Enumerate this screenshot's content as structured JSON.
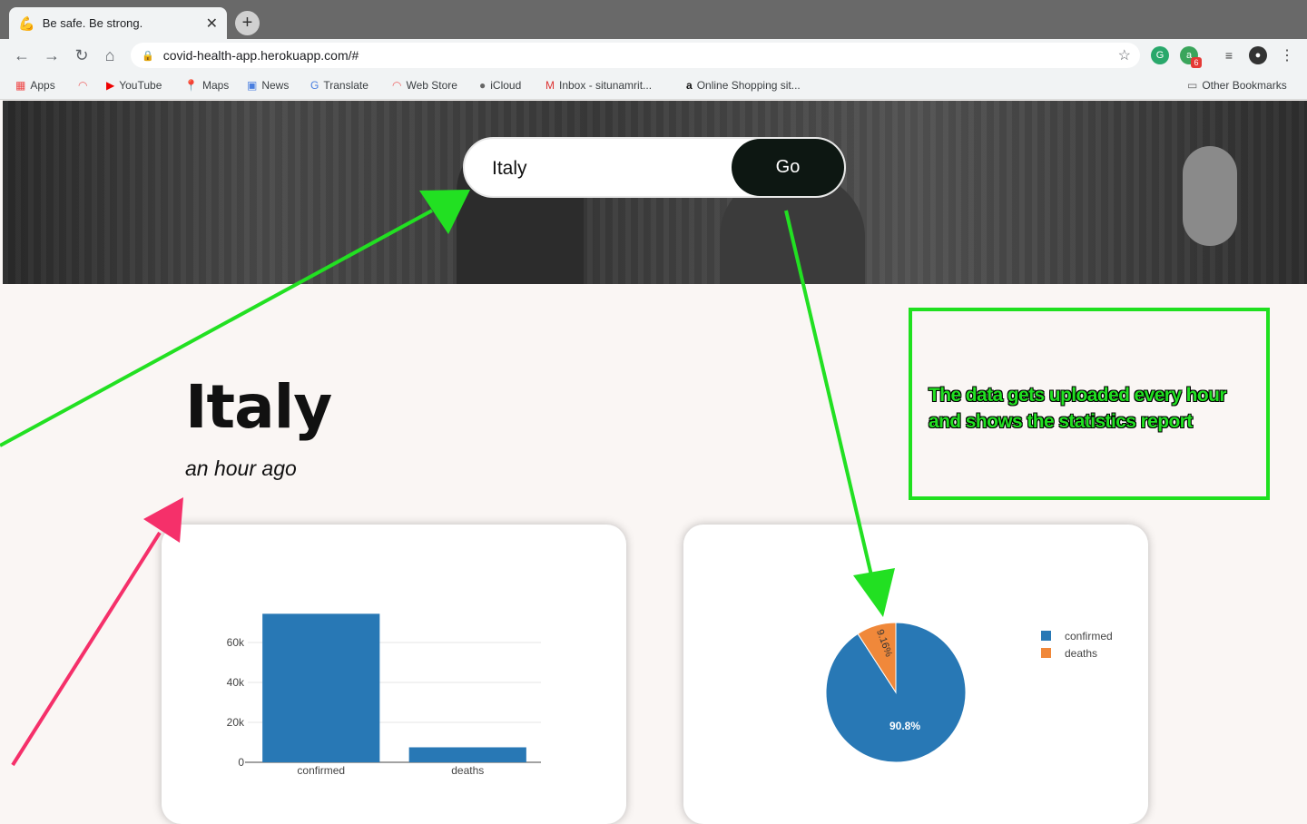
{
  "browser": {
    "tab_title": "Be safe. Be strong.",
    "url": "covid-health-app.herokuapp.com/#",
    "ext_badge": "6",
    "bookmarks": [
      {
        "label": "Apps",
        "icon": "apps-grid-icon"
      },
      {
        "label": "",
        "icon": "rainbow-icon"
      },
      {
        "label": "YouTube",
        "icon": "youtube-icon"
      },
      {
        "label": "Maps",
        "icon": "maps-icon"
      },
      {
        "label": "News",
        "icon": "news-icon"
      },
      {
        "label": "Translate",
        "icon": "translate-icon"
      },
      {
        "label": "Web Store",
        "icon": "webstore-icon"
      },
      {
        "label": "iCloud",
        "icon": "apple-icon"
      },
      {
        "label": "Inbox - situnamrit...",
        "icon": "gmail-icon"
      },
      {
        "label": "Online Shopping sit...",
        "icon": "amazon-icon"
      }
    ],
    "other_bookmarks": "Other Bookmarks"
  },
  "search": {
    "value": "Italy",
    "go_label": "Go"
  },
  "country": {
    "name": "Italy",
    "updated": "an hour ago"
  },
  "annotation": {
    "note": "The data gets uploaded every hour and shows the statistics report",
    "arrow_color": "#22e022",
    "pink_arrow_color": "#f5306a"
  },
  "chart_data": [
    {
      "type": "bar",
      "categories": [
        "confirmed",
        "deaths"
      ],
      "values": [
        74386,
        7503
      ],
      "ylim": [
        0,
        75000
      ],
      "yticks": [
        "0",
        "20k",
        "40k",
        "60k"
      ],
      "ytick_values": [
        0,
        20000,
        40000,
        60000
      ],
      "color": "#2878b5"
    },
    {
      "type": "pie",
      "labels": [
        "confirmed",
        "deaths"
      ],
      "values": [
        90.8,
        9.16
      ],
      "slice_labels": [
        "90.8%",
        "9.16%"
      ],
      "colors": [
        "#2878b5",
        "#f0883a"
      ],
      "legend": "top-right"
    }
  ]
}
